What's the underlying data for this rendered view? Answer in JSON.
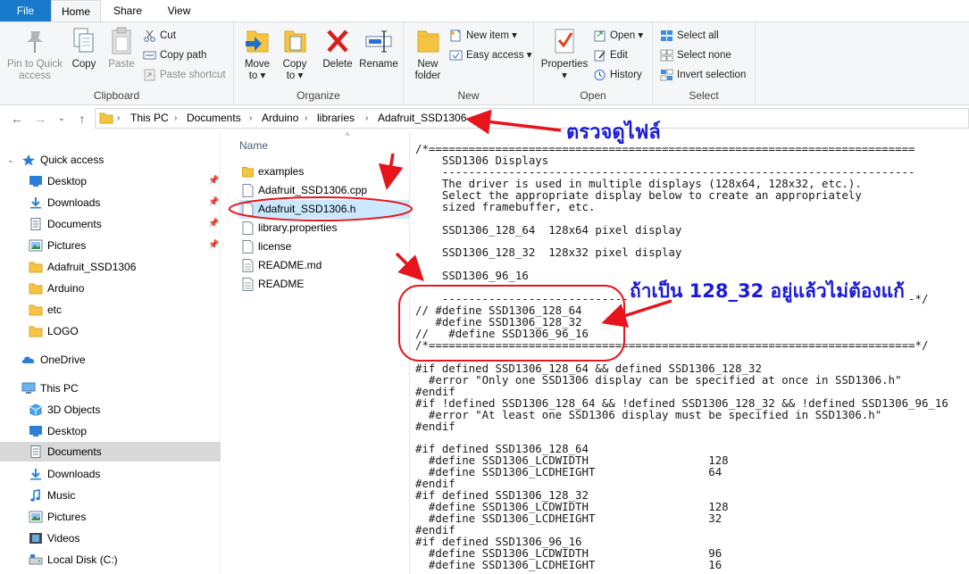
{
  "ribbon_tabs": {
    "file": "File",
    "home": "Home",
    "share": "Share",
    "view": "View"
  },
  "clipboard": {
    "label": "Clipboard",
    "pin_line1": "Pin to Quick",
    "pin_line2": "access",
    "copy": "Copy",
    "paste": "Paste",
    "cut": "Cut",
    "copy_path": "Copy path",
    "paste_shortcut": "Paste shortcut"
  },
  "organize": {
    "label": "Organize",
    "move_to_line1": "Move",
    "move_to_line2": "to ▾",
    "copy_to_line1": "Copy",
    "copy_to_line2": "to ▾",
    "delete": "Delete",
    "rename": "Rename"
  },
  "new": {
    "label": "New",
    "new_folder_line1": "New",
    "new_folder_line2": "folder",
    "new_item": "New item ▾",
    "easy_access": "Easy access ▾"
  },
  "open": {
    "label": "Open",
    "properties": "Properties",
    "properties_caret": "▾",
    "open": "Open ▾",
    "edit": "Edit",
    "history": "History"
  },
  "select": {
    "label": "Select",
    "select_all": "Select all",
    "select_none": "Select none",
    "invert_selection": "Invert selection"
  },
  "breadcrumb": [
    "This PC",
    "Documents",
    "Arduino",
    "libraries",
    "Adafruit_SSD1306"
  ],
  "nav_pane": {
    "quick_access": "Quick access",
    "quick_items": [
      {
        "label": "Desktop",
        "icon": "desktop-icon"
      },
      {
        "label": "Downloads",
        "icon": "downloads-icon"
      },
      {
        "label": "Documents",
        "icon": "documents-icon"
      },
      {
        "label": "Pictures",
        "icon": "pictures-icon"
      },
      {
        "label": "Adafruit_SSD1306",
        "icon": "folder-icon"
      },
      {
        "label": "Arduino",
        "icon": "folder-icon"
      },
      {
        "label": "etc",
        "icon": "folder-icon"
      },
      {
        "label": "LOGO",
        "icon": "folder-icon"
      }
    ],
    "onedrive": "OneDrive",
    "this_pc": "This PC",
    "pc_items": [
      {
        "label": "3D Objects",
        "icon": "3d-objects-icon"
      },
      {
        "label": "Desktop",
        "icon": "desktop-icon"
      },
      {
        "label": "Documents",
        "icon": "documents-icon"
      },
      {
        "label": "Downloads",
        "icon": "downloads-icon"
      },
      {
        "label": "Music",
        "icon": "music-icon"
      },
      {
        "label": "Pictures",
        "icon": "pictures-icon"
      },
      {
        "label": "Videos",
        "icon": "videos-icon"
      },
      {
        "label": "Local Disk (C:)",
        "icon": "local-disk-icon"
      }
    ]
  },
  "file_list": {
    "column_name": "Name",
    "items": [
      {
        "label": "examples",
        "icon": "folder-icon"
      },
      {
        "label": "Adafruit_SSD1306.cpp",
        "icon": "file-icon"
      },
      {
        "label": "Adafruit_SSD1306.h",
        "icon": "file-icon"
      },
      {
        "label": "library.properties",
        "icon": "file-icon"
      },
      {
        "label": "license",
        "icon": "file-icon"
      },
      {
        "label": "README.md",
        "icon": "file-icon"
      },
      {
        "label": "README",
        "icon": "file-icon"
      }
    ]
  },
  "code_lines": [
    "/*=========================================================================",
    "    SSD1306 Displays",
    "    -----------------------------------------------------------------------",
    "    The driver is used in multiple displays (128x64, 128x32, etc.).",
    "    Select the appropriate display below to create an appropriately",
    "    sized framebuffer, etc.",
    "",
    "    SSD1306_128_64  128x64 pixel display",
    "",
    "    SSD1306_128_32  128x32 pixel display",
    "",
    "    SSD1306_96_16",
    "",
    "    -----------------------------------------------------------------------*/",
    "// #define SSD1306_128_64",
    "   #define SSD1306_128_32",
    "//   #define SSD1306_96_16",
    "/*=========================================================================*/",
    "",
    "#if defined SSD1306_128_64 && defined SSD1306_128_32",
    "  #error \"Only one SSD1306 display can be specified at once in SSD1306.h\"",
    "#endif",
    "#if !defined SSD1306_128_64 && !defined SSD1306_128_32 && !defined SSD1306_96_16",
    "  #error \"At least one SSD1306 display must be specified in SSD1306.h\"",
    "#endif",
    "",
    "#if defined SSD1306_128_64",
    "  #define SSD1306_LCDWIDTH                  128",
    "  #define SSD1306_LCDHEIGHT                 64",
    "#endif",
    "#if defined SSD1306_128_32",
    "  #define SSD1306_LCDWIDTH                  128",
    "  #define SSD1306_LCDHEIGHT                 32",
    "#endif",
    "#if defined SSD1306_96_16",
    "  #define SSD1306_LCDWIDTH                  96",
    "  #define SSD1306_LCDHEIGHT                 16"
  ],
  "annotations": {
    "check_file": "ตรวจดูไฟล์",
    "note_128_32": "ถ้าเป็น 128_32 อยู่แล้วไม่ต้องแก้",
    "color": "#1a1ad9",
    "mark_color": "#e8141c"
  }
}
